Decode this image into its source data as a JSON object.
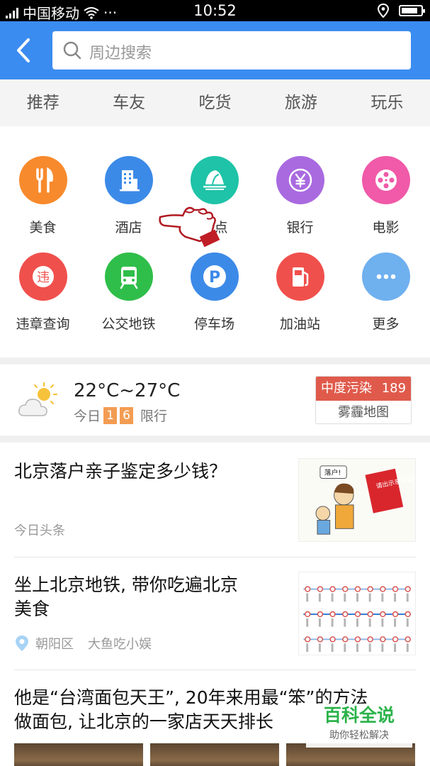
{
  "status_bar": {
    "carrier": "中国移动",
    "more": "···",
    "time": "10:52",
    "battery_level": 0.85
  },
  "header": {
    "search_placeholder": "周边搜索"
  },
  "tabs": [
    {
      "label": "推荐",
      "active": true
    },
    {
      "label": "车友",
      "active": false
    },
    {
      "label": "吃货",
      "active": false
    },
    {
      "label": "旅游",
      "active": false
    },
    {
      "label": "玩乐",
      "active": false
    }
  ],
  "categories": [
    {
      "label": "美食",
      "icon": "fork-knife-icon",
      "color": "#f78a2c"
    },
    {
      "label": "酒店",
      "icon": "building-icon",
      "color": "#3c8ae8"
    },
    {
      "label": "景点",
      "icon": "opera-house-icon",
      "color": "#1fc3a7"
    },
    {
      "label": "银行",
      "icon": "yuan-icon",
      "color": "#a96ae0"
    },
    {
      "label": "电影",
      "icon": "film-reel-icon",
      "color": "#f05aa8"
    },
    {
      "label": "违章查询",
      "icon": "violation-icon",
      "color": "#f0504c"
    },
    {
      "label": "公交地铁",
      "icon": "bus-icon",
      "color": "#2fbe4a"
    },
    {
      "label": "停车场",
      "icon": "parking-icon",
      "color": "#3c8ae8"
    },
    {
      "label": "加油站",
      "icon": "gas-pump-icon",
      "color": "#f0504c"
    },
    {
      "label": "更多",
      "icon": "more-icon",
      "color": "#6fb0ef"
    }
  ],
  "weather": {
    "temperature": "22°C~27°C",
    "today_label": "今日",
    "plate_1": "1",
    "plate_2": "6",
    "restriction_label": "限行",
    "pollution_label": "中度污染",
    "pollution_value": "189",
    "haze_map": "雾霾地图"
  },
  "news": [
    {
      "title": "北京落户亲子鉴定多少钱？",
      "source": "今日头条"
    },
    {
      "title_line1": "坐上北京地铁, 带你吃遍北京",
      "title_line2": "美食",
      "location": "朝阳区",
      "author": "大鱼吃小娱"
    },
    {
      "title_line1": "他是“台湾面包天王”, 20年来用最“笨”的方法",
      "title_line2": "做面包, 让北京的一家店天天排长"
    }
  ],
  "watermark": {
    "main": "百科全说",
    "sub": "助你轻松解决"
  },
  "thumb_texts": {
    "bubble": "落户!",
    "book": "请出示亲子证明"
  }
}
